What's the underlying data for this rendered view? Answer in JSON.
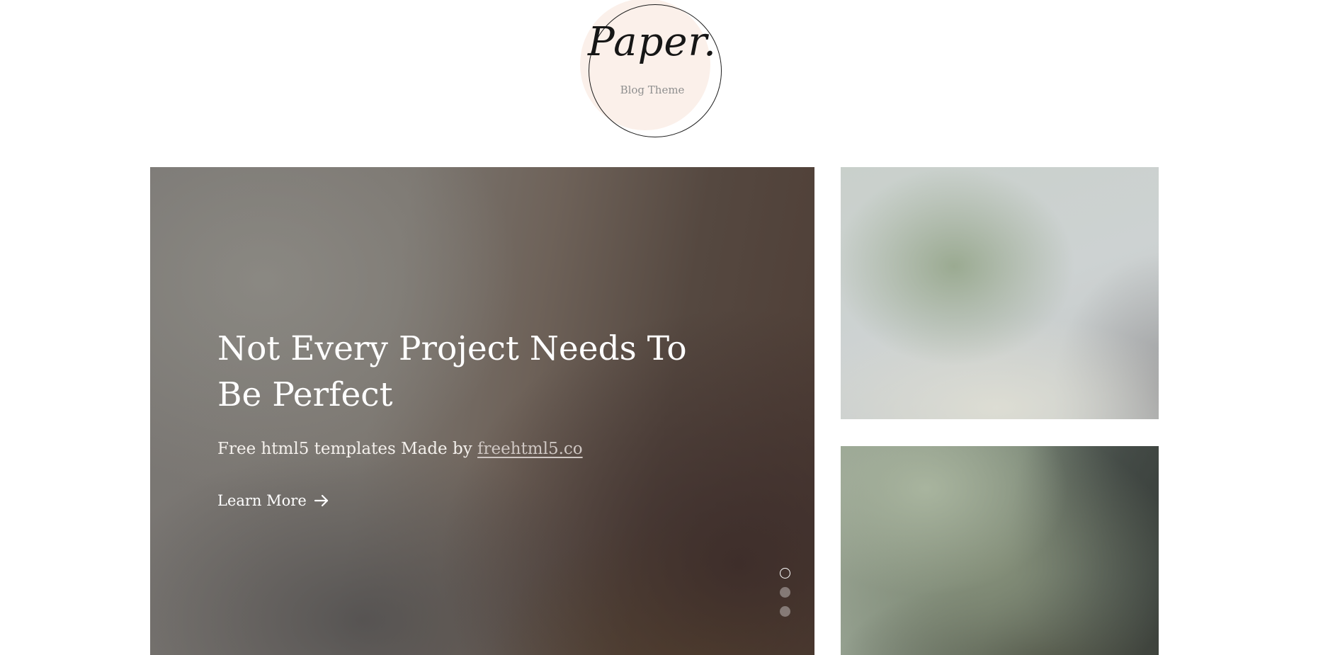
{
  "logo": {
    "title": "Paper.",
    "subtitle": "Blog Theme"
  },
  "hero": {
    "title": "Not Every Project Needs To Be Perfect",
    "subtitle_prefix": "Free html5 templates Made by ",
    "subtitle_link": "freehtml5.co",
    "cta_label": "Learn More",
    "cta_icon": "arrow-right-icon",
    "slides_total": 3,
    "active_slide": 1
  },
  "cards": [
    {
      "name": "featured-card-top"
    },
    {
      "name": "featured-card-bottom"
    }
  ],
  "colors": {
    "background": "#ffffff",
    "logo_blob": "#fbf0ea",
    "hero_text": "#ffffff",
    "link_text": "#cfc7c3"
  }
}
